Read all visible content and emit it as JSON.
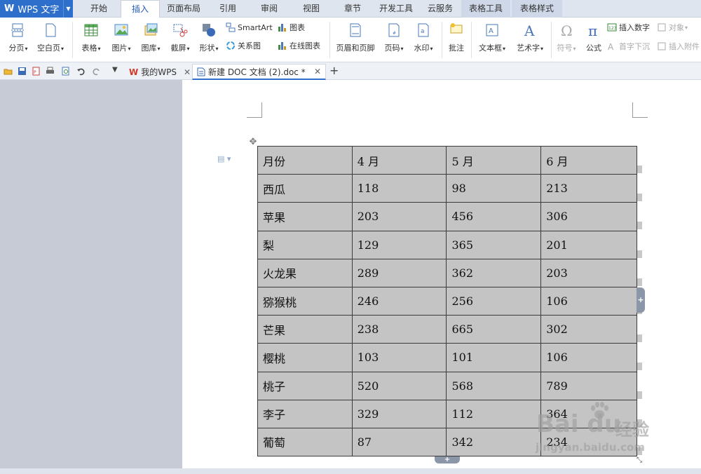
{
  "app": {
    "name": "WPS 文字"
  },
  "menu_tabs": [
    "开始",
    "插入",
    "页面布局",
    "引用",
    "审阅",
    "视图",
    "章节",
    "开发工具",
    "云服务",
    "表格工具",
    "表格样式"
  ],
  "active_tab": "插入",
  "ribbon": {
    "page_break": "分页",
    "blank_page": "空白页",
    "table": "表格",
    "picture": "图片",
    "gallery": "图库",
    "screenshot": "截屏",
    "shape": "形状",
    "smartart": "SmartArt",
    "relation": "关系图",
    "chart": "图表",
    "online_chart": "在线图表",
    "header_footer": "页眉和页脚",
    "page_number": "页码",
    "watermark": "水印",
    "comment": "批注",
    "textbox": "文本框",
    "wordart": "艺术字",
    "symbol": "符号",
    "formula": "公式",
    "insert_number": "插入数字",
    "object": "对象",
    "dropcap": "首字下沉",
    "attachment": "插入附件"
  },
  "doc_tabs": [
    {
      "label": "我的WPS"
    },
    {
      "label": "新建 DOC 文档 (2).doc *"
    }
  ],
  "table": {
    "rows": [
      [
        "月份",
        "4 月",
        "5 月",
        "6 月"
      ],
      [
        "西瓜",
        "118",
        "98",
        "213"
      ],
      [
        "苹果",
        "203",
        "456",
        "306"
      ],
      [
        "梨",
        "129",
        "365",
        "201"
      ],
      [
        "火龙果",
        "289",
        "362",
        "203"
      ],
      [
        "猕猴桃",
        "246",
        "256",
        "106"
      ],
      [
        "芒果",
        "238",
        "665",
        "302"
      ],
      [
        "樱桃",
        "103",
        "101",
        "106"
      ],
      [
        "桃子",
        "520",
        "568",
        "789"
      ],
      [
        "李子",
        "329",
        "112",
        "364"
      ],
      [
        "葡萄",
        "87",
        "342",
        "234"
      ]
    ]
  },
  "watermark": {
    "brand": "Bai du",
    "cn": "经验",
    "url": "jingyan.baidu.com"
  },
  "colors": {
    "accent": "#2d6fcb",
    "cell_fill": "#c4c4c4",
    "left_pane": "#c6cbd5"
  }
}
